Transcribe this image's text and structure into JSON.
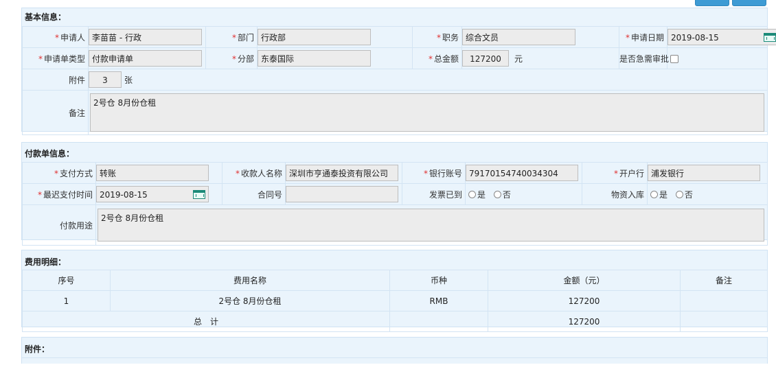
{
  "basic": {
    "title": "基本信息：",
    "applicant_label": "申请人",
    "applicant_value": "李苗苗 - 行政",
    "dept_label": "部门",
    "dept_value": "行政部",
    "post_label": "职务",
    "post_value": "综合文员",
    "date_label": "申请日期",
    "date_value": "2019-08-15",
    "type_label": "申请单类型",
    "type_value": "付款申请单",
    "branch_label": "分部",
    "branch_value": "东泰国际",
    "total_label": "总金额",
    "total_value": "127200",
    "total_unit": "元",
    "urgent_label": "是否急需审批",
    "attach_label": "附件",
    "attach_value": "3",
    "attach_unit": "张",
    "remark_label": "备注",
    "remark_value": "2号仓 8月份仓租"
  },
  "payment": {
    "title": "付款单信息：",
    "method_label": "支付方式",
    "method_value": "转账",
    "payee_label": "收款人名称",
    "payee_value": "深圳市亨通泰投资有限公司",
    "account_label": "银行账号",
    "account_value": "79170154740034304",
    "bank_label": "开户行",
    "bank_value": "浦发银行",
    "latest_label": "最迟支付时间",
    "latest_value": "2019-08-15",
    "contract_label": "合同号",
    "contract_value": "",
    "invoice_label": "发票已到",
    "stock_label": "物资入库",
    "yes": "是",
    "no": "否",
    "purpose_label": "付款用途",
    "purpose_value": "2号仓 8月份仓租"
  },
  "expense": {
    "title": "费用明细：",
    "headers": [
      "序号",
      "费用名称",
      "币种",
      "金额（元）",
      "备注"
    ],
    "rows": [
      {
        "no": "1",
        "name": "2号仓 8月份仓租",
        "currency": "RMB",
        "amount": "127200",
        "remark": ""
      }
    ],
    "total_label": "总　计",
    "total_amount": "127200"
  },
  "attachments": {
    "title": "附件："
  },
  "colors": {
    "accent": "#3e9bd4",
    "required": "#e03030",
    "panel": "#eaf4fc"
  }
}
